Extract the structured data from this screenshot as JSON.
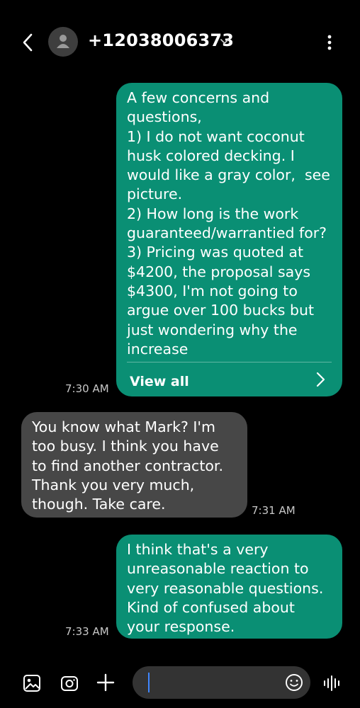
{
  "header": {
    "contact_number": "+12038006373",
    "icons": [
      "back-arrow-icon",
      "person-icon",
      "chevron-down-icon",
      "more-vertical-icon"
    ]
  },
  "messages": [
    {
      "direction": "outgoing",
      "text": "A few concerns and\nquestions,\n1) I do not want coconut\nhusk colored decking. I\nwould like a gray color,  see\npicture.\n2) How long is the work\nguaranteed/warrantied for?\n3) Pricing was quoted at\n$4200, the proposal says\n$4300, I'm not going to\nargue over 100 bucks but\njust wondering why the\nincrease",
      "view_all_label": "View all",
      "time": "7:30 AM"
    },
    {
      "direction": "incoming",
      "text": "You know what Mark? I'm\ntoo busy. I think you have\nto find another contractor.\nThank you very much,\nthough. Take care.",
      "time": "7:31 AM"
    },
    {
      "direction": "outgoing",
      "text": "I think that's a very\nunreasonable reaction to\nvery reasonable questions.\nKind of confused about\nyour response.",
      "time": "7:33 AM"
    }
  ],
  "composer": {
    "input_value": "",
    "icons": [
      "gallery-icon",
      "camera-icon",
      "plus-icon",
      "emoji-icon",
      "voice-icon"
    ]
  },
  "colors": {
    "background": "#000000",
    "outgoing_bubble": "#0a8f74",
    "incoming_bubble": "#474747",
    "input_field": "#333333",
    "cursor": "#3f86ff"
  }
}
